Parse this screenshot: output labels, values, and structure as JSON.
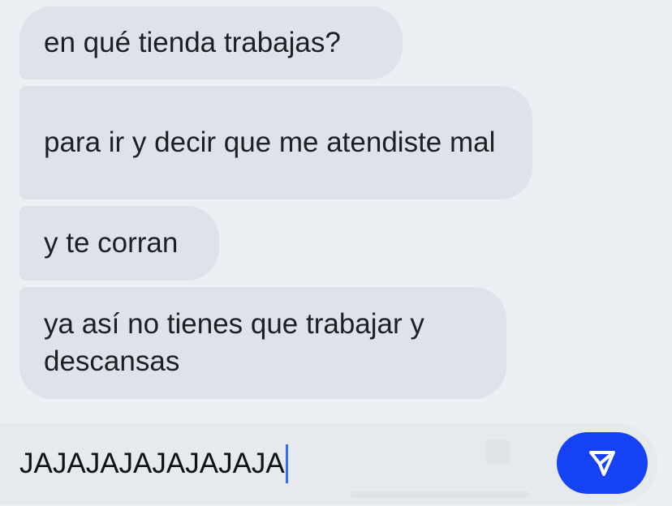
{
  "messages": [
    {
      "text": "en qué tienda trabajas?"
    },
    {
      "text": "para ir y decir que me atendiste mal"
    },
    {
      "text": "y te corran"
    },
    {
      "text": "ya así no tienes que trabajar y descansas"
    }
  ],
  "composer": {
    "value": "JAJAJAJAJAJAJAJA",
    "send_icon": "send-arrow-icon",
    "send_color": "#1642f5"
  },
  "theme": {
    "background": "#eceff3",
    "bubble": "#dfe2ea"
  }
}
